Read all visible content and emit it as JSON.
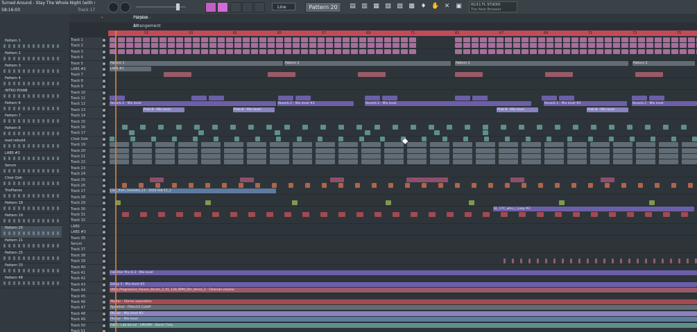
{
  "song": {
    "title": "Turned Around - Stay The Whole Night (with soul",
    "time": "58:16:03",
    "track_readout": "Track 17"
  },
  "transport": {
    "mode": "Line",
    "pattern": "Pattern 20"
  },
  "news": {
    "line1": "01/11  FL STUDIO",
    "line2": "The New Browser"
  },
  "window": {
    "title": "Playlist - Arrangement",
    "pattern": "Pattern 20"
  },
  "ruler": [
    "53",
    "33",
    "61",
    "65",
    "57",
    "69",
    "71",
    "65",
    "67",
    "69",
    "71",
    "73",
    "75"
  ],
  "patterns": [
    "Pattern 1",
    "Pattern 2",
    "Pattern 3",
    "Pattern 4",
    "INTRO POIAB",
    "Pattern 6",
    "Pattern 7",
    "Pattern 8",
    "lead rebuild",
    "LABS #2",
    "Serum",
    "Choir Ooh",
    "TrioPianos",
    "Pattern 18",
    "Pattern 19",
    "Pattern 20",
    "Pattern 21",
    "Pattern 25",
    "Pattern 33",
    "Pattern 48"
  ],
  "tracks": [
    "Track 1",
    "Track 2",
    "Track 3",
    "Track 4",
    "Track 5",
    "LABS #2",
    "Track 7",
    "Track 8",
    "Track 9",
    "Track 10",
    "Track 11",
    "Track 12",
    "Track 13",
    "Track 14",
    "Track 15",
    "Track 16",
    "Track 17",
    "Choir Ooh",
    "Track 19",
    "Track 20",
    "Track 21",
    "Track 22",
    "Track 23",
    "Track 24",
    "Track 25",
    "Track 26",
    "Track 27",
    "Track 28",
    "Track 29",
    "Track 30",
    "Track 31",
    "Track 32",
    "LABS",
    "LABS #3",
    "Track 35",
    "Serum",
    "Track 37",
    "Track 38",
    "Track 39",
    "Track 40",
    "Track 41",
    "Track 42",
    "Track 43",
    "Track 44",
    "Track 45",
    "Track 46",
    "Track 47",
    "Track 48",
    "Track 49",
    "Track 50",
    "Track 51"
  ],
  "clips": {
    "pattern1": "Pattern 1",
    "pattern2": "Pattern 2",
    "labs": "LABS #1",
    "reverb": "Reverb 2 - Mix level",
    "reverb2": "Reverb 2 - Mix level #2",
    "fxlevel": "Fab BB - Mix level",
    "live": "Live_from_hometel_11 - 2022-feb-11_2",
    "fabfilter": "FabFilter Pro-Q 3 - Mix level",
    "delay": "Delay 3 - Mix level #2",
    "ultra": "Ultra_Progressive_House_Vocals_2_01_128_BPM_Dm_Verse_2 - Channel volume",
    "master": "Master - Stereo separation",
    "speedsel": "Speedsel - Filter/LX Cutoff",
    "phaser": "Phaser - Mix level #2",
    "phaser2": "Phaser - Mix level",
    "lastrow": "Fab6 - Lab.kit.vol - LM/LMH - Band / freq",
    "sl": "SL_17C_who_i_Loop #2",
    "prob": "Prob B - Mix level"
  }
}
